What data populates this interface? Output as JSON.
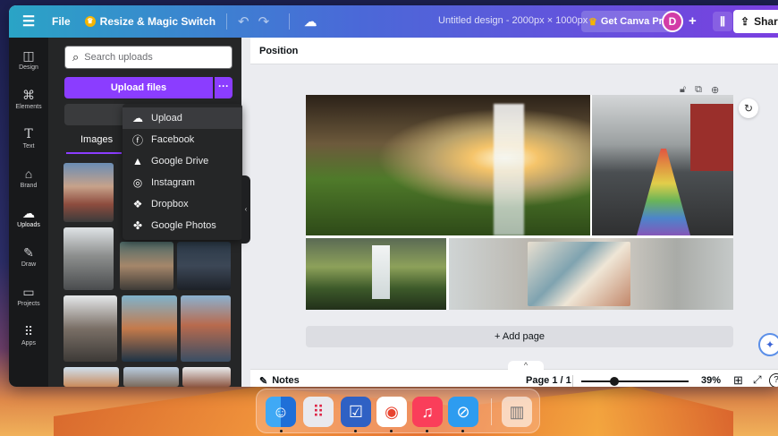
{
  "topbar": {
    "file": "File",
    "resize": "Resize & Magic Switch",
    "title": "Untitled design - 2000px × 1000px",
    "pro": "Get Canva Pro",
    "avatar": "D",
    "share": "Share"
  },
  "rail": [
    {
      "label": "Design",
      "icon": "layout-icon"
    },
    {
      "label": "Elements",
      "icon": "shapes-icon"
    },
    {
      "label": "Text",
      "icon": "text-icon"
    },
    {
      "label": "Brand",
      "icon": "brand-icon"
    },
    {
      "label": "Uploads",
      "icon": "cloud-upload-icon"
    },
    {
      "label": "Draw",
      "icon": "pen-icon"
    },
    {
      "label": "Projects",
      "icon": "folder-icon"
    },
    {
      "label": "Apps",
      "icon": "apps-grid-icon"
    }
  ],
  "panel": {
    "search_placeholder": "Search uploads",
    "upload_button": "Upload files",
    "more": "···",
    "tab_images": "Images"
  },
  "dropdown": [
    {
      "label": "Upload",
      "icon": "cloud-upload-icon"
    },
    {
      "label": "Facebook",
      "icon": "facebook-icon"
    },
    {
      "label": "Google Drive",
      "icon": "google-drive-icon"
    },
    {
      "label": "Instagram",
      "icon": "instagram-icon"
    },
    {
      "label": "Dropbox",
      "icon": "dropbox-icon"
    },
    {
      "label": "Google Photos",
      "icon": "google-photos-icon"
    }
  ],
  "editor": {
    "position": "Position",
    "add_page": "+ Add page"
  },
  "footer": {
    "notes": "Notes",
    "page": "Page 1 / 1",
    "zoom": "39%",
    "zoom_fraction": 0.39
  },
  "dock": [
    "Finder",
    "Launchpad",
    "Tasks",
    "Chrome",
    "Music",
    "Safari",
    "Trash"
  ],
  "colors": {
    "accent": "#8b3dff",
    "panel": "#252627",
    "rail": "#18191b"
  }
}
